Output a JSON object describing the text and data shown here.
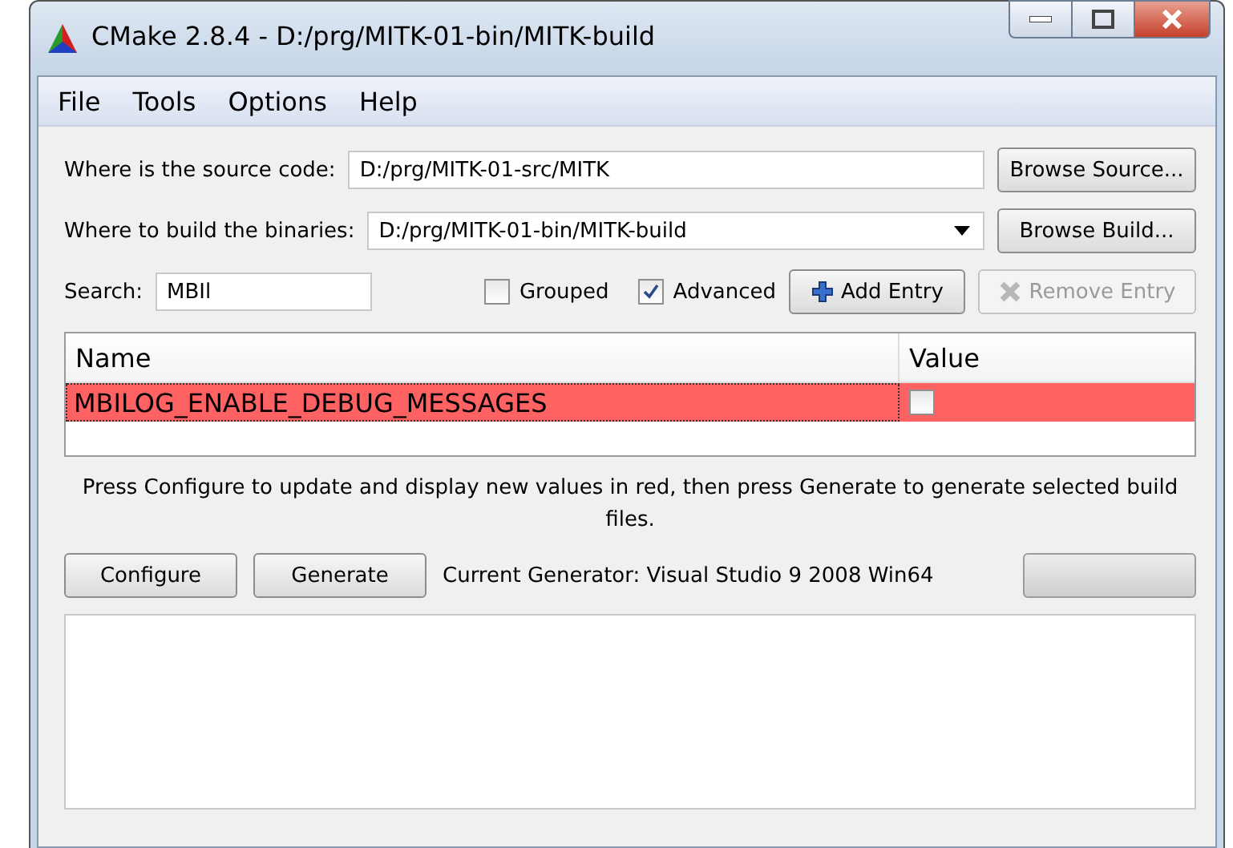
{
  "window": {
    "title": "CMake 2.8.4 - D:/prg/MITK-01-bin/MITK-build"
  },
  "menu": [
    "File",
    "Tools",
    "Options",
    "Help"
  ],
  "source": {
    "label": "Where is the source code:",
    "value": "D:/prg/MITK-01-src/MITK",
    "button": "Browse Source..."
  },
  "build": {
    "label": "Where to build the binaries:",
    "value": "D:/prg/MITK-01-bin/MITK-build",
    "button": "Browse Build..."
  },
  "search": {
    "label": "Search:",
    "value": "MBIl"
  },
  "options": [
    {
      "label": "Grouped",
      "checked": false
    },
    {
      "label": "Advanced",
      "checked": true
    }
  ],
  "add_entry": {
    "label": "Add Entry",
    "disabled": false
  },
  "remove_entry": {
    "label": "Remove Entry",
    "disabled": true
  },
  "table": {
    "columns": [
      "Name",
      "Value"
    ],
    "rows": [
      {
        "name": "MBILOG_ENABLE_DEBUG_MESSAGES",
        "checked": false,
        "new": true
      }
    ]
  },
  "hint": "Press Configure to update and display new values in red, then press Generate to generate selected build files.",
  "buttons": [
    "Configure",
    "Generate"
  ],
  "generator": "Current Generator: Visual Studio 9 2008 Win64",
  "progress": {
    "level": 0
  }
}
